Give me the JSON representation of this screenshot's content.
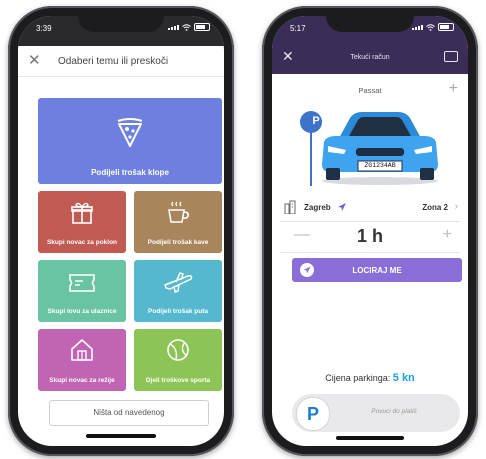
{
  "phone_left": {
    "status_time": "3:39",
    "header": {
      "title": "Odaberi temu ili preskoči"
    },
    "tiles": [
      {
        "label": "Podijeli trošak klope",
        "icon": "pizza-icon",
        "color": "#6d80e0"
      },
      {
        "label": "Skupi novac za poklon",
        "icon": "gift-icon",
        "color": "#c05a52"
      },
      {
        "label": "Podijeli trošak kave",
        "icon": "coffee-icon",
        "color": "#a8855a"
      },
      {
        "label": "Skupi lovu za ulaznice",
        "icon": "ticket-icon",
        "color": "#68c4a2"
      },
      {
        "label": "Podijeli trošak puta",
        "icon": "airplane-icon",
        "color": "#55b8cf"
      },
      {
        "label": "Skupi novac za režije",
        "icon": "house-icon",
        "color": "#c264b4"
      },
      {
        "label": "Djeli troškove sporta",
        "icon": "ball-icon",
        "color": "#8cc455"
      }
    ],
    "none_button": "Ništa od navedenog"
  },
  "phone_right": {
    "status_time": "5:17",
    "header": {
      "title": "Tekući račun"
    },
    "car": {
      "name": "Passat",
      "plate": "ZG1234AB",
      "color": "#3fa4f0"
    },
    "parking_sign": "P",
    "location": {
      "city": "Zagreb",
      "zone": "Zona 2"
    },
    "duration": {
      "value": "1 h",
      "minus": "—",
      "plus": "+"
    },
    "locate_button": "LOCIRAJ ME",
    "price": {
      "label": "Cijena parkinga:",
      "value": "5 kn"
    },
    "slider": {
      "knob": "P",
      "text": "Povuci do platiš"
    }
  }
}
